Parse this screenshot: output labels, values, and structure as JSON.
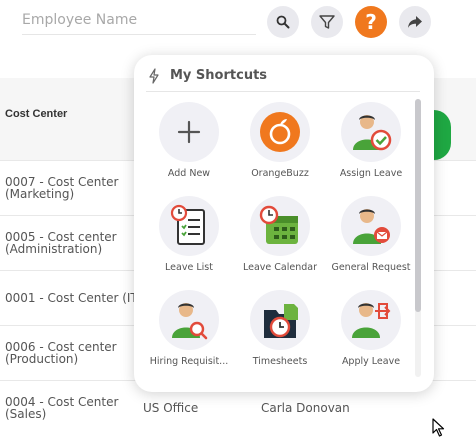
{
  "topbar": {
    "search_placeholder": "Employee Name",
    "help_label": "?",
    "icons": [
      "search-icon",
      "filter-icon",
      "help-icon",
      "share-icon"
    ]
  },
  "table": {
    "column_header": "Cost Center",
    "rows": [
      {
        "cost_center_line1": "0007 - Cost Center",
        "cost_center_line2": "(Marketing)",
        "location": "",
        "manager": ""
      },
      {
        "cost_center_line1": "0005 - Cost center",
        "cost_center_line2": "(Administration)",
        "location": "",
        "manager": ""
      },
      {
        "cost_center_line1": "0001 - Cost Center (IT)",
        "cost_center_line2": "",
        "location": "",
        "manager": ""
      },
      {
        "cost_center_line1": "0006 - Cost center",
        "cost_center_line2": "(Production)",
        "location": "",
        "manager": ""
      },
      {
        "cost_center_line1": "0004 - Cost Center",
        "cost_center_line2": "(Sales)",
        "location": "US Office",
        "manager": "Carla Donovan"
      }
    ]
  },
  "shortcuts": {
    "title": "My Shortcuts",
    "items": [
      {
        "label": "Add New",
        "icon": "plus-icon"
      },
      {
        "label": "OrangeBuzz",
        "icon": "orangebuzz-icon"
      },
      {
        "label": "Assign Leave",
        "icon": "assign-leave-icon"
      },
      {
        "label": "Leave List",
        "icon": "leave-list-icon"
      },
      {
        "label": "Leave Calendar",
        "icon": "leave-calendar-icon"
      },
      {
        "label": "General Request",
        "icon": "general-request-icon"
      },
      {
        "label": "Hiring Requisit...",
        "icon": "hiring-requisition-icon"
      },
      {
        "label": "Timesheets",
        "icon": "timesheets-icon"
      },
      {
        "label": "Apply Leave",
        "icon": "apply-leave-icon"
      }
    ]
  },
  "colors": {
    "accent_orange": "#f0781e",
    "green_action": "#1fa843",
    "icon_bg": "#f0f0f5"
  }
}
